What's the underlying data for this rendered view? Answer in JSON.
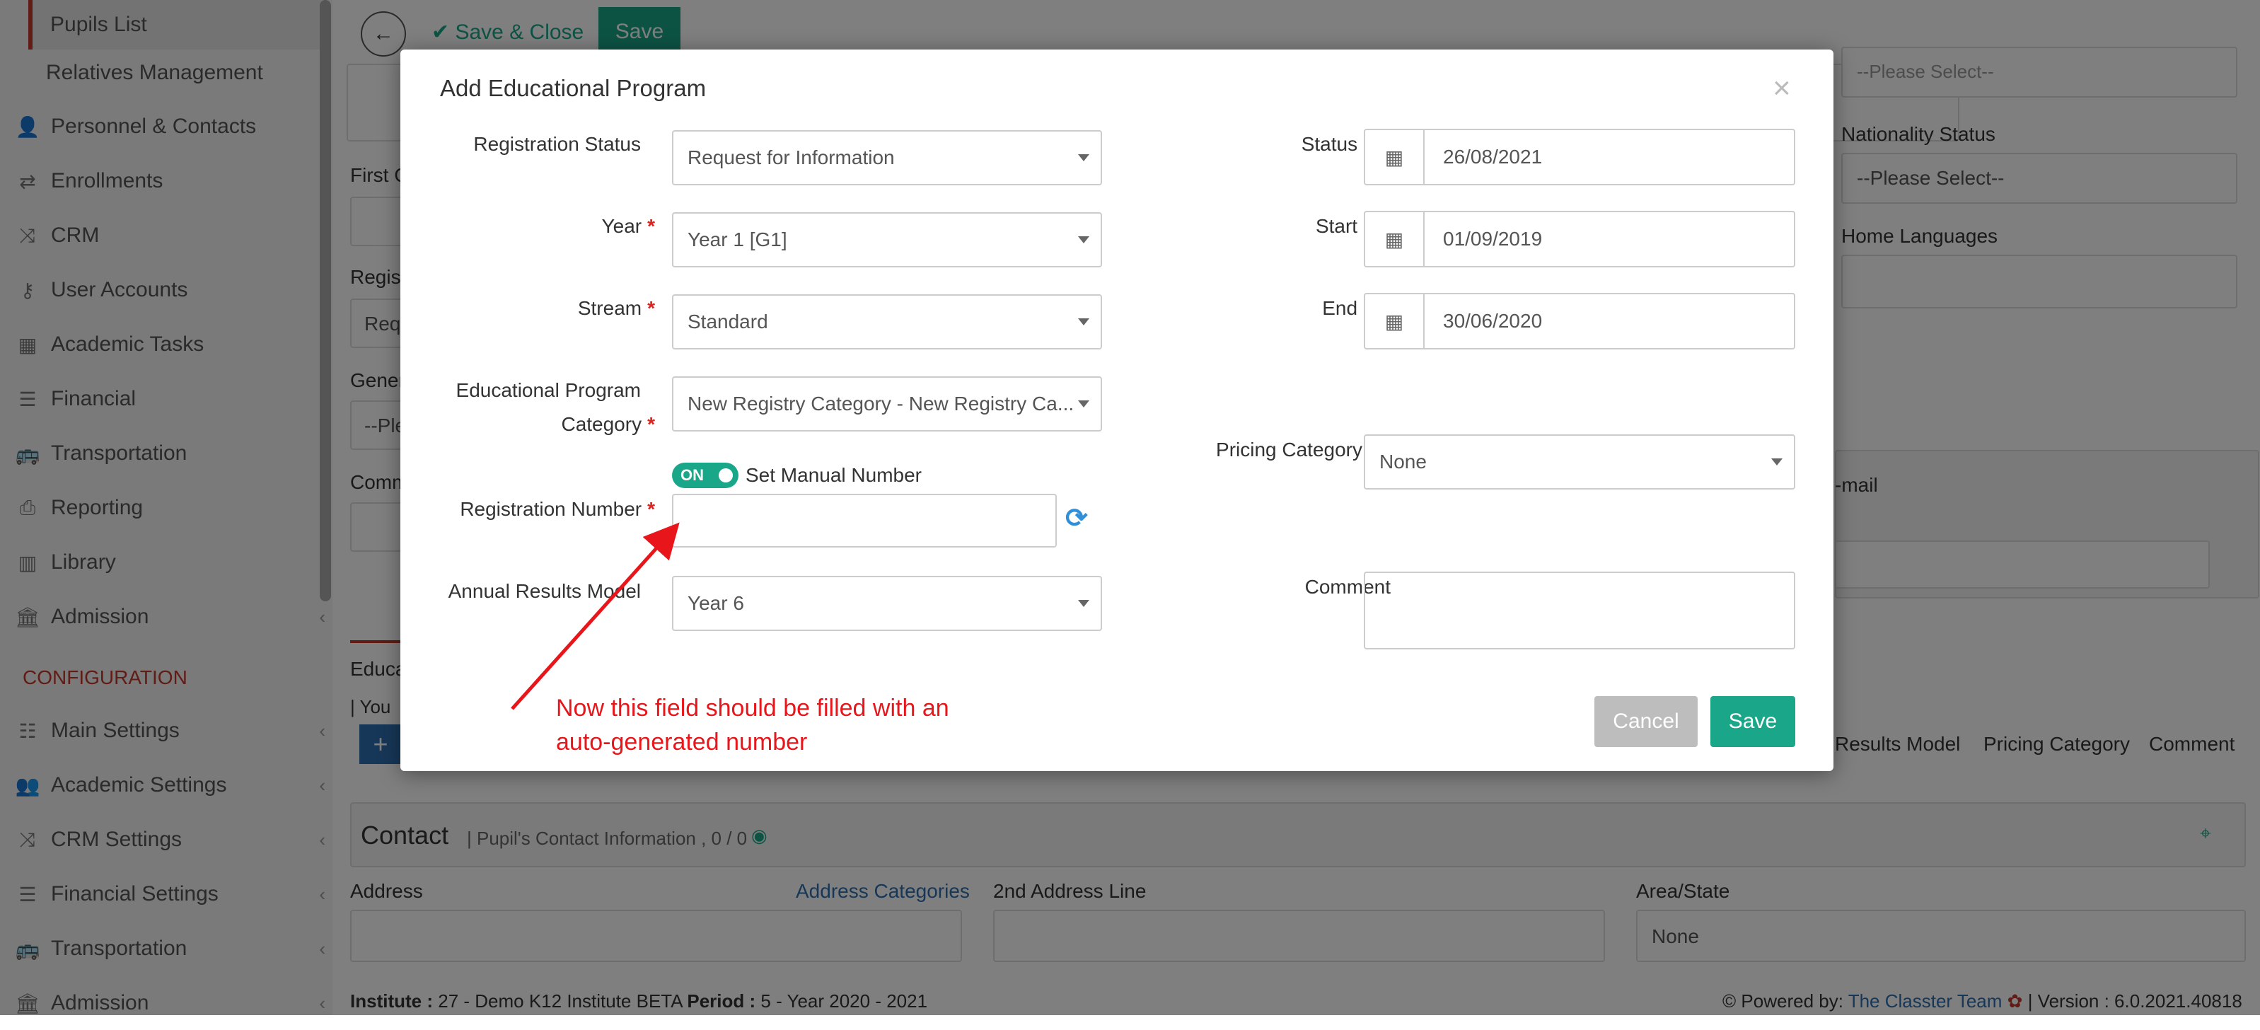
{
  "sidebar": {
    "sub_items": [
      "Pupils List",
      "Relatives Management"
    ],
    "items": [
      "Personnel & Contacts",
      "Enrollments",
      "CRM",
      "User Accounts",
      "Academic Tasks",
      "Financial",
      "Transportation",
      "Reporting",
      "Library",
      "Admission"
    ],
    "config_header": "CONFIGURATION",
    "config_items": [
      "Main Settings",
      "Academic Settings",
      "CRM Settings",
      "Financial Settings",
      "Transportation",
      "Admission"
    ]
  },
  "toolbar": {
    "save_close": "Save & Close",
    "save": "Save"
  },
  "background": {
    "please_select": "--Please Select--",
    "nationality_status": "Nationality Status",
    "home_languages": "Home Languages",
    "first_c": "First C",
    "regist": "Regist",
    "req": "Req",
    "gener": "Gener",
    "ple": "--Ple",
    "comm": "Comm",
    "mail": "-mail",
    "educa": "Educa",
    "you": "| You",
    "results_model": "Results Model",
    "pricing_category": "Pricing Category",
    "comment": "Comment",
    "contact_title": "Contact",
    "contact_sub": "| Pupil's Contact Information , 0 / 0",
    "address": "Address",
    "address_categories": "Address Categories",
    "address2": "2nd Address Line",
    "area_state": "Area/State",
    "none": "None",
    "footer_left_a": "Institute :",
    "footer_left_b": "27 - Demo K12 Institute BETA",
    "footer_left_c": "Period :",
    "footer_left_d": "5 - Year 2020 - 2021",
    "powered": "Powered by:",
    "team": "The Classter Team",
    "version": "| Version : 6.0.2021.40818"
  },
  "modal": {
    "title": "Add Educational Program",
    "close": "×",
    "registration_status_label": "Registration Status",
    "registration_status_value": "Request for Information",
    "year_label": "Year",
    "year_value": "Year 1 [G1]",
    "stream_label": "Stream",
    "stream_value": "Standard",
    "category_label_1": "Educational Program",
    "category_label_2": "Category",
    "category_value": "New Registry Category - New Registry Ca...",
    "toggle": "ON",
    "manual_number": "Set Manual Number",
    "registration_number_label": "Registration Number",
    "registration_number_value": "",
    "annual_results_label": "Annual Results Model",
    "annual_results_value": "Year 6",
    "status_date_label": "Status Date",
    "status_date_value": "26/08/2021",
    "start_date_label": "Start Date",
    "start_date_value": "01/09/2019",
    "end_date_label": "End Date",
    "end_date_value": "30/06/2020",
    "pricing_label": "Pricing Category",
    "pricing_value": "None",
    "comment_label": "Comment",
    "cancel": "Cancel",
    "save": "Save",
    "required_mark": "*"
  },
  "annotation": {
    "line1": "Now this field should be filled with an",
    "line2": "auto-generated number",
    "color": "#e8161b"
  },
  "colors": {
    "accent": "#1aa789",
    "required": "#d9251d",
    "link": "#2f6fb0"
  }
}
